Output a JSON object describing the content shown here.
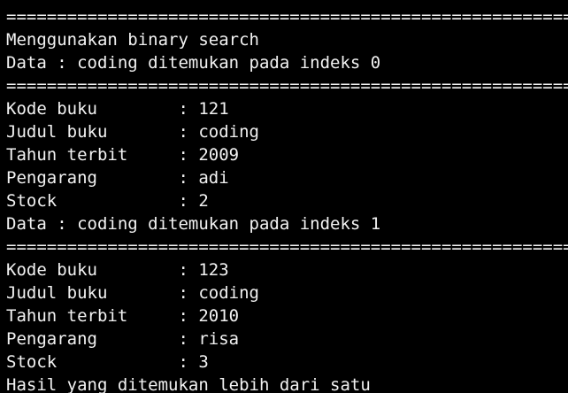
{
  "terminal": {
    "lines": [
      "",
      "=========================================================",
      "Menggunakan binary search",
      "Data : coding ditemukan pada indeks 0",
      "=========================================================",
      "Kode buku        : 121",
      "Judul buku       : coding",
      "Tahun terbit     : 2009",
      "Pengarang        : adi",
      "Stock            : 2",
      "Data : coding ditemukan pada indeks 1",
      "=========================================================",
      "Kode buku        : 123",
      "Judul buku       : coding",
      "Tahun terbit     : 2010",
      "Pengarang        : risa",
      "Stock            : 3",
      "Hasil yang ditemukan lebih dari satu"
    ]
  }
}
